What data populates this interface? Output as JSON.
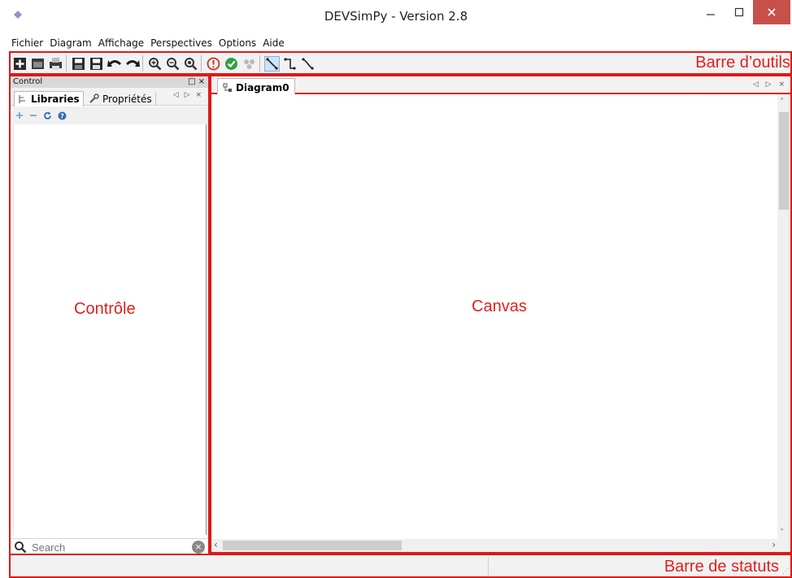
{
  "window": {
    "title": "DEVSimPy - Version 2.8",
    "minimize": "—",
    "maximize": "☐",
    "close": "✕"
  },
  "menu": [
    "Fichier",
    "Diagram",
    "Affichage",
    "Perspectives",
    "Options",
    "Aide"
  ],
  "toolbar": {
    "caption": "Barre d’outils",
    "icons": [
      "new-icon",
      "open-icon",
      "print-icon",
      "save-icon",
      "save-as-icon",
      "undo-icon",
      "redo-icon",
      "zoom-in-icon",
      "zoom-out-icon",
      "zoom-reset-icon",
      "check-icon",
      "simulate-icon",
      "plugins-icon",
      "direct-connector-icon",
      "square-connector-icon",
      "linear-connector-icon"
    ]
  },
  "control": {
    "header": "Control",
    "header_icons": "□ ×",
    "tabs": [
      "Libraries",
      "Propriétés"
    ],
    "tab_nav": "◁ ▷ ×",
    "search_placeholder": "Search",
    "caption": "Contrôle"
  },
  "canvas": {
    "tab": "Diagram0",
    "tab_nav": "◁ ▷ ×",
    "caption": "Canvas"
  },
  "statusbar": {
    "caption": "Barre de statuts"
  },
  "colors": {
    "annotation": "#e02020",
    "close_button": "#c7504b",
    "active_tool": "#cce4f7"
  }
}
